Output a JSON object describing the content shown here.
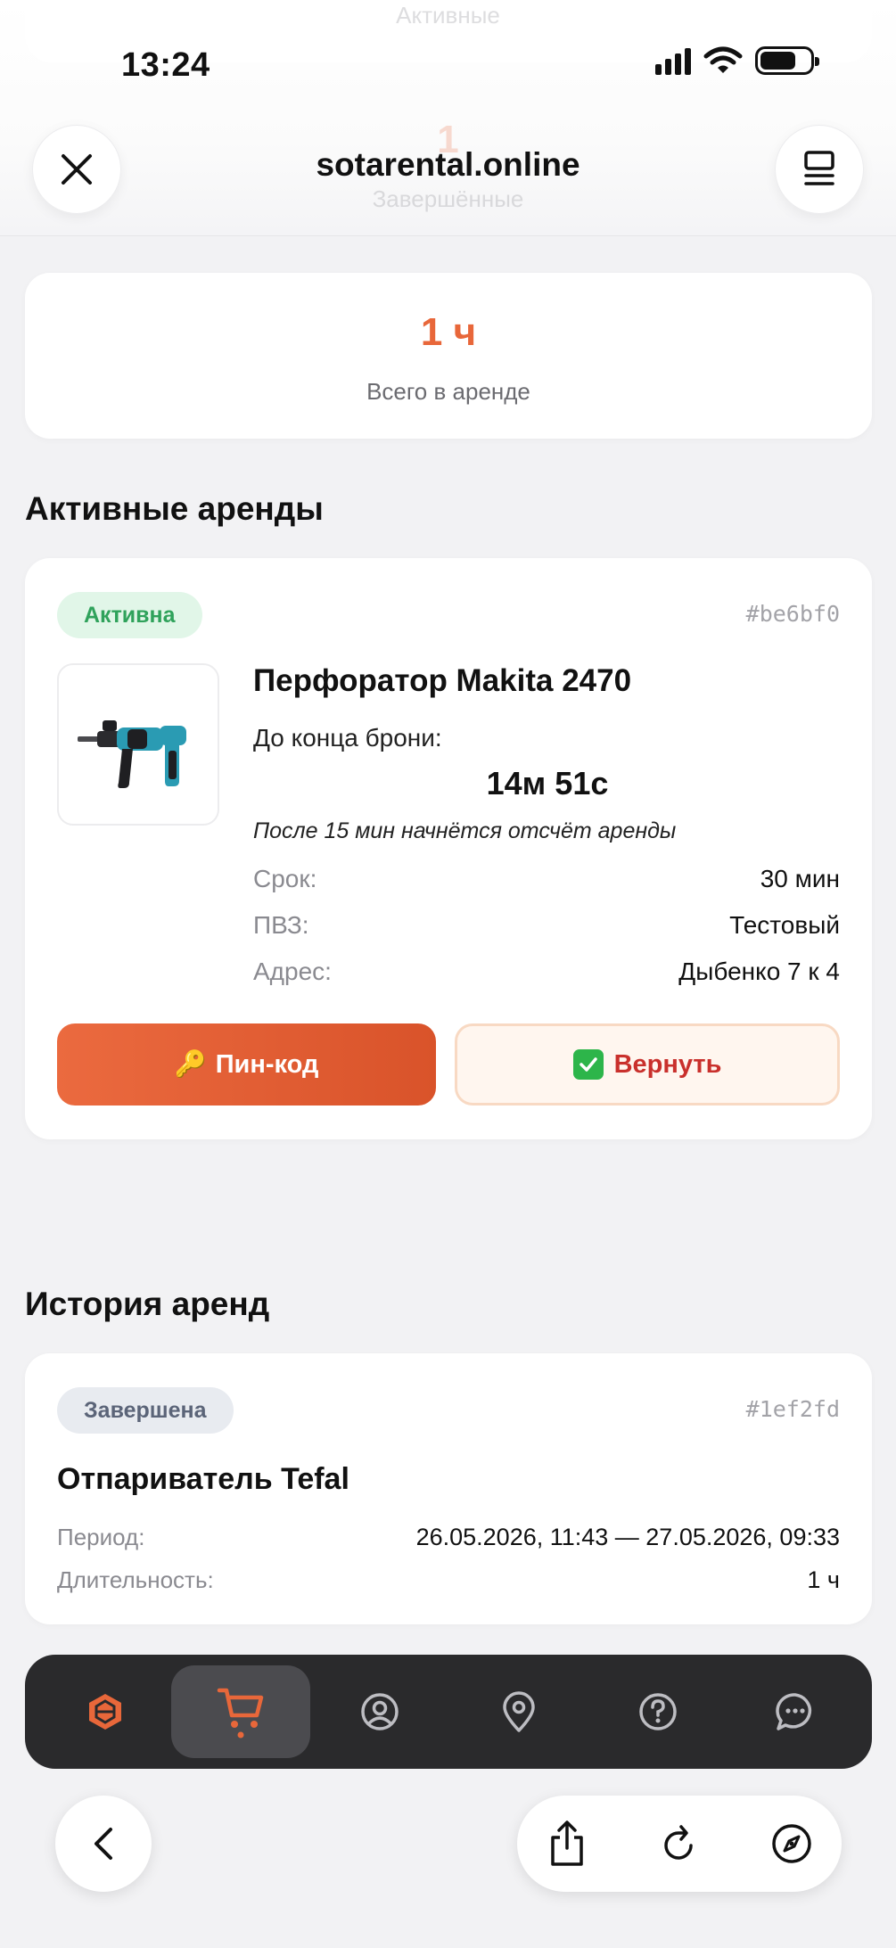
{
  "status_bar": {
    "time": "13:24"
  },
  "browser": {
    "url": "sotarental.online",
    "ghost_top_text": "Активные",
    "ghost_count": "1",
    "ghost_label": "Завершённые"
  },
  "summary": {
    "value": "1 ч",
    "label": "Всего в аренде"
  },
  "active_section": {
    "title": "Активные аренды",
    "rental": {
      "status": "Активна",
      "id": "#be6bf0",
      "product": "Перфоратор Makita 2470",
      "until_label": "До конца брони:",
      "timer": "14м 51с",
      "note": "После 15 мин начнётся отсчёт аренды",
      "details": [
        {
          "label": "Срок:",
          "value": "30 мин"
        },
        {
          "label": "ПВЗ:",
          "value": "Тестовый"
        },
        {
          "label": "Адрес:",
          "value": "Дыбенко 7 к 4"
        }
      ],
      "pin_button": "Пин-код",
      "pin_icon": "🔑",
      "return_button": "Вернуть"
    }
  },
  "history_section": {
    "title": "История аренд",
    "items": [
      {
        "status": "Завершена",
        "id": "#1ef2fd",
        "product": "Отпариватель Tefal",
        "period_label": "Период:",
        "period_value": "26.05.2026, 11:43 — 27.05.2026, 09:33",
        "duration_label": "Длительность:",
        "duration_value": "1 ч"
      }
    ]
  },
  "nav": {
    "items": [
      "logo-icon",
      "cart-icon",
      "profile-icon",
      "location-icon",
      "help-icon",
      "chat-icon"
    ],
    "active": "cart-icon"
  },
  "colors": {
    "accent": "#e8673a",
    "active_badge_bg": "#e1f6e8",
    "active_badge_text": "#2fa25b",
    "done_badge_bg": "#e8ebf0",
    "return_text": "#c9302c",
    "nav_bg": "#2a2a2c"
  }
}
